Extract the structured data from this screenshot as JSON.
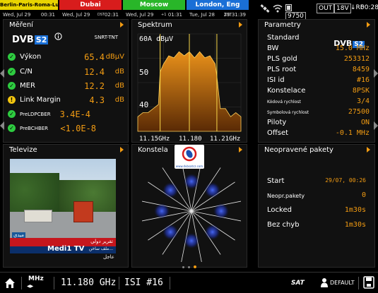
{
  "topbar": {
    "clocks": [
      {
        "city": "Berlin-Paris-Roma-Lučenec",
        "date": "Wed, Jul 29",
        "dst": "",
        "time": "00:31"
      },
      {
        "city": "Dubai",
        "date": "Wed, Jul 29",
        "dst": "DST",
        "time": "02:31"
      },
      {
        "city": "Moscow",
        "date": "Wed, Jul 29",
        "dst": "+1",
        "time": "01:31"
      },
      {
        "city": "London, Eng",
        "date": "Tue, Jul 28",
        "dst": "DST",
        "time": "23:31:39"
      }
    ],
    "battery": "9750",
    "out": "OUT",
    "voltage": "18V",
    "rf": "RF",
    "clock": "00:28"
  },
  "measurements": {
    "title": "Měření",
    "standard_logo": "DVB S2",
    "standard_sub": "SNRT-TNT",
    "rows": [
      {
        "label": "Výkon",
        "value": "65.4",
        "unit": "dBμV",
        "status": "ok"
      },
      {
        "label": "C/N",
        "value": "12.4",
        "unit": "dB",
        "status": "ok"
      },
      {
        "label": "MER",
        "value": "12.2",
        "unit": "dB",
        "status": "ok"
      },
      {
        "label": "Link Margin",
        "value": "4.3",
        "unit": "dB",
        "status": "warn"
      },
      {
        "label": "PreLDPCBER",
        "value": "3.4E-4",
        "unit": "",
        "status": "ok"
      },
      {
        "label": "PreBCHBER",
        "value": "<1.0E-8",
        "unit": "",
        "status": "ok"
      }
    ]
  },
  "spectrum": {
    "title": "Spektrum",
    "ref_level": "60A dBμV",
    "tick_labels": [
      "50",
      "40"
    ],
    "freq_labels": [
      "11.15GHz",
      "11.180",
      "11.21GHz"
    ]
  },
  "chart_data": {
    "type": "area",
    "title": "Spektrum",
    "xlabel": "",
    "ylabel": "dBμV",
    "x": [
      11.15,
      11.153,
      11.156,
      11.159,
      11.162,
      11.163,
      11.165,
      11.168,
      11.171,
      11.174,
      11.177,
      11.18,
      11.183,
      11.186,
      11.189,
      11.192,
      11.195,
      11.196,
      11.198,
      11.201,
      11.204,
      11.207,
      11.21
    ],
    "values": [
      41,
      41,
      42,
      42,
      44,
      51,
      54,
      55,
      55.5,
      56,
      56,
      56,
      55.5,
      56,
      55.5,
      55,
      54,
      50,
      43,
      42,
      41,
      41,
      41
    ],
    "xlim": [
      11.15,
      11.21
    ],
    "ylim": [
      37,
      61
    ],
    "grid": true
  },
  "parameters": {
    "title": "Parametry",
    "logo": "DVB S2",
    "rows": [
      {
        "key": "Standard",
        "value": "",
        "small": false
      },
      {
        "key": "BW",
        "value": "15.0 MHz",
        "small": false
      },
      {
        "key": "PLS gold",
        "value": "253312",
        "small": false
      },
      {
        "key": "PLS root",
        "value": "8459",
        "small": false
      },
      {
        "key": "ISI id",
        "value": "#16",
        "small": false
      },
      {
        "key": "Konstelace",
        "value": "8PSK",
        "small": false
      },
      {
        "key": "Kódová rychlost",
        "value": "3/4",
        "small": true
      },
      {
        "key": "Symbolová rychlost",
        "value": "27500",
        "small": true
      },
      {
        "key": "Piloty",
        "value": "ON",
        "small": false
      },
      {
        "key": "Offset",
        "value": "-0.1 MHz",
        "small": false
      }
    ]
  },
  "tv": {
    "title": "Televize",
    "channel_name": "Medi1 TV",
    "logo_text": "ميدي",
    "ticker": "عاجل",
    "banner": "تقرير دولي",
    "caption": "ملف ساخن..."
  },
  "constellation": {
    "title": "Konstela",
    "watermark": "www.dvbsatcz.com"
  },
  "packets": {
    "title": "Neopravené pakety",
    "rows": [
      {
        "key": "Start",
        "value": "29/07, 00:26",
        "small": true
      },
      {
        "key": "Neopr.pakety",
        "value": "0",
        "small": true
      },
      {
        "key": "Locked",
        "value": "1m30s",
        "small": false
      },
      {
        "key": "Bez chyb",
        "value": "1m30s",
        "small": false
      }
    ]
  },
  "bottombar": {
    "freq": "11.180 GHz",
    "isi": "ISI #16",
    "mhz_label": "MHz",
    "sat_label": "SAT",
    "profile": "DEFAULT"
  },
  "colors": {
    "accent": "#f39c12",
    "ok": "#2ecc40",
    "warn": "#f1c40f",
    "spectrum_fill_top": "#e8901a",
    "spectrum_fill_bottom": "#5a2a05"
  }
}
